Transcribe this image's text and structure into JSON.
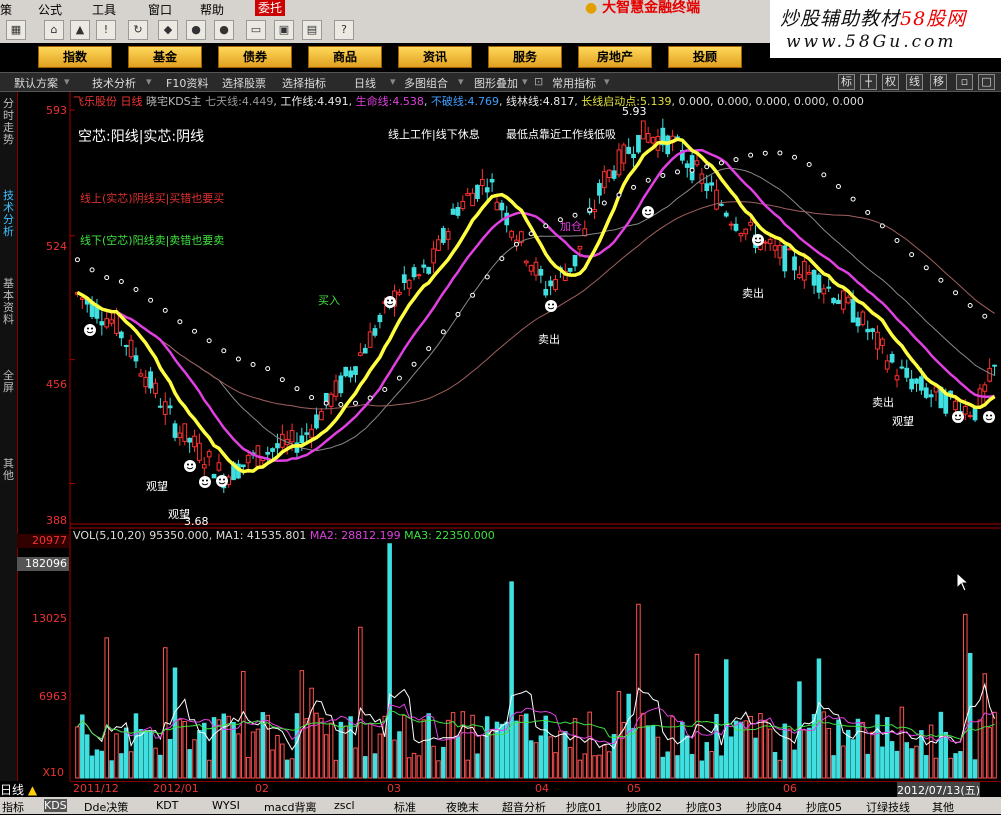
{
  "menu": [
    "策",
    "公式",
    "工具",
    "窗口",
    "帮助"
  ],
  "menu_trade": "委托",
  "brand": "大智慧金融终端",
  "watermark": {
    "title_a": "炒股辅助教材",
    "title_b": "58股网",
    "url": "www.58Gu.com"
  },
  "categories": [
    "指数",
    "基金",
    "债券",
    "商品",
    "资讯",
    "服务",
    "房地产",
    "投顾"
  ],
  "function_bar": [
    "默认方案",
    "技术分析",
    "F10资料",
    "选择股票",
    "选择指标",
    "日线",
    "多图组合",
    "图形叠加",
    "常用指标"
  ],
  "right_buttons": [
    "标",
    "权",
    "线",
    "移"
  ],
  "left_tabs": [
    "分时走势",
    "技术分析",
    "基本资料",
    "全屏",
    "其他"
  ],
  "price_axis": [
    "593",
    "524",
    "456",
    "388"
  ],
  "volume_axis": [
    "20977",
    "182096",
    "13025",
    "6963",
    "X10"
  ],
  "info": {
    "stock": "飞乐股份",
    "period": "日线",
    "indicator": "晓宅KDS主",
    "items": [
      {
        "label": "七天线:",
        "value": "4.449",
        "color": "#9a9a9a"
      },
      {
        "label": "工作线:",
        "value": "4.491",
        "color": "#e8e8e8"
      },
      {
        "label": "生命线:",
        "value": "4.538",
        "color": "#e040e0"
      },
      {
        "label": "不破线:",
        "value": "4.769",
        "color": "#40a0ff"
      },
      {
        "label": "线林线:",
        "value": "4.817",
        "color": "#e8e8e8"
      },
      {
        "label": "长线启动点:",
        "value": "5.139",
        "color": "#e0e040"
      }
    ],
    "tail": "0.000, 0.000, 0.000, 0.000, 0.000"
  },
  "volume_info": {
    "label": "VOL(5,10,20)",
    "vol": "95350.000",
    "ma1": "MA1: 41535.801",
    "ma2": "MA2: 28812.199",
    "ma3": "MA3: 22350.000"
  },
  "annotations": {
    "legend": "空芯:阳线|实芯:阴线",
    "top_a": "线上工作|线下休息",
    "top_b": "最低点靠近工作线低吸",
    "line_red": "线上(实芯)阴线买|买错也要买",
    "line_green": "线下(空芯)阳线卖|卖错也要卖",
    "price_high": "5.93",
    "price_low": "3.68",
    "sell": "卖出",
    "watch": "观望",
    "buy_in": "买入",
    "add": "加仓"
  },
  "dates": [
    "2011/12",
    "2012/01",
    "02",
    "03",
    "04",
    "05",
    "06",
    "2012/07/13(五)"
  ],
  "bottom_tabs": [
    "指标",
    "KDS",
    "Dde决策",
    "KDT",
    "WYSI",
    "macd背离",
    "zscl",
    "标准",
    "夜晚末",
    "超音分析",
    "抄底01",
    "抄底02",
    "抄底03",
    "抄底04",
    "抄底05",
    "订绿技线",
    "其他"
  ],
  "period_label": "日线",
  "chart_data": {
    "type": "candlestick",
    "price_axis": {
      "max": 5.93,
      "min": 3.68,
      "ticks": [
        5.93,
        5.24,
        4.56,
        3.88
      ]
    },
    "volume_axis": {
      "ticks": [
        20977,
        18209.6,
        13025,
        6963
      ]
    },
    "colors": {
      "up": "#ff3030",
      "down": "#40e0e0",
      "work_line": "#ffff40",
      "life_line": "#e040e0",
      "dots": "#ffffff"
    }
  }
}
